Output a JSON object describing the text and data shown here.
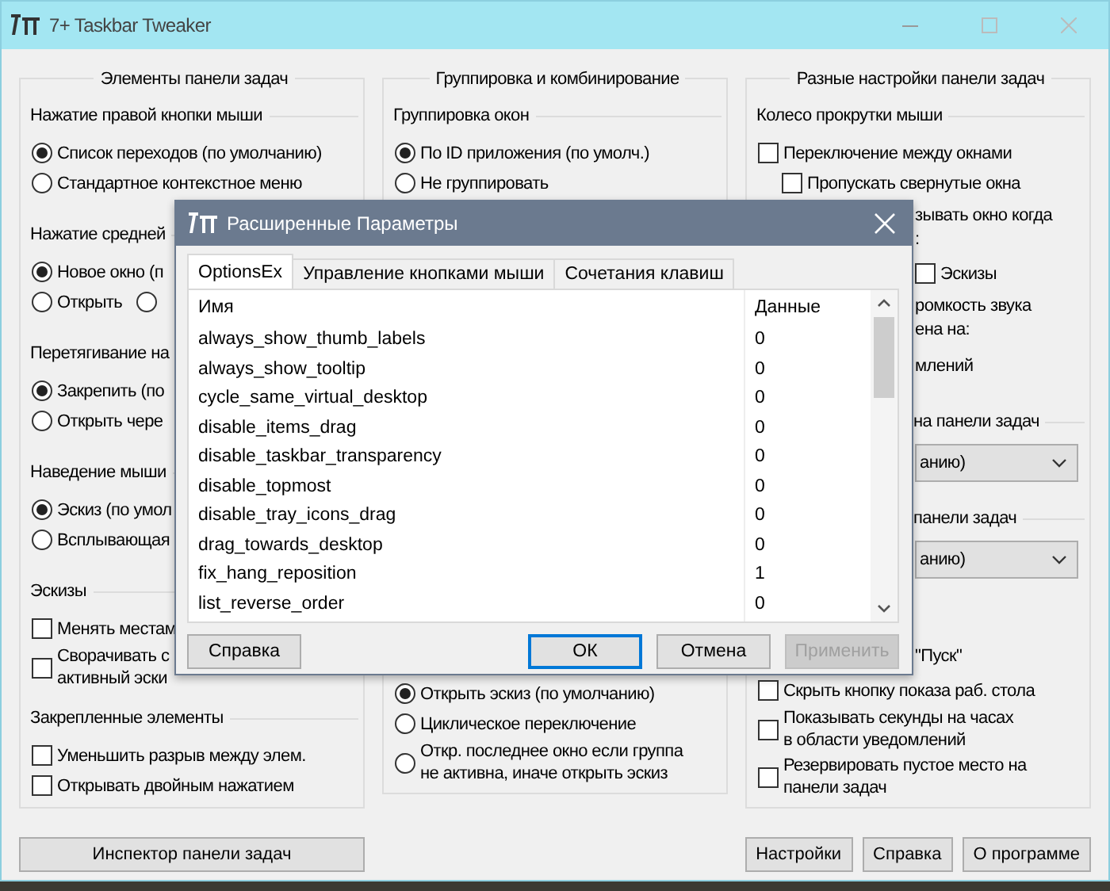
{
  "window": {
    "title": "7+ Taskbar Tweaker"
  },
  "columns": [
    {
      "title": "Элементы панели задач",
      "sections": [
        {
          "title": "Нажатие правой кнопки мыши",
          "items": [
            {
              "kind": "radio",
              "label": "Список переходов (по умолчанию)",
              "selected": true
            },
            {
              "kind": "radio",
              "label": "Стандартное контекстное меню",
              "selected": false
            }
          ]
        },
        {
          "title": "Нажатие средней",
          "items": [
            {
              "kind": "radio",
              "label": "Новое окно (п",
              "selected": true
            },
            {
              "kind": "radio-row",
              "options": [
                {
                  "label": "Открыть",
                  "selected": false
                },
                {
                  "selected": false
                }
              ]
            }
          ]
        },
        {
          "title": "Перетягивание на",
          "items": [
            {
              "kind": "radio",
              "label": "Закрепить (по",
              "selected": true
            },
            {
              "kind": "radio",
              "label": "Открыть чере",
              "selected": false
            }
          ]
        },
        {
          "title": "Наведение мыши",
          "items": [
            {
              "kind": "radio",
              "label": "Эскиз (по умол",
              "selected": true
            },
            {
              "kind": "radio",
              "label": "Всплывающая",
              "selected": false
            }
          ]
        },
        {
          "title": "Эскизы",
          "items": [
            {
              "kind": "checkbox",
              "label": "Менять местам",
              "checked": false
            },
            {
              "kind": "checkbox",
              "label": "Сворачивать с\nактивный эски",
              "checked": false
            }
          ]
        },
        {
          "title": "Закрепленные элементы",
          "items": [
            {
              "kind": "checkbox",
              "label": "Уменьшить разрыв между элем.",
              "checked": false
            },
            {
              "kind": "checkbox",
              "label": "Открывать двойным нажатием",
              "checked": false
            }
          ]
        }
      ],
      "buttons": [
        "Инспектор панели задач"
      ]
    },
    {
      "title": "Группировка и комбинирование",
      "sections": [
        {
          "title": "Группировка окон",
          "items": [
            {
              "kind": "radio",
              "label": "По ID приложения (по умолч.)",
              "selected": true
            },
            {
              "kind": "radio",
              "label": "Не группировать",
              "selected": false
            }
          ]
        },
        {
          "items": [
            {
              "kind": "radio",
              "label": "Открыть эскиз (по умолчанию)",
              "selected": true
            },
            {
              "kind": "radio",
              "label": "Циклическое переключение",
              "selected": false
            },
            {
              "kind": "radio",
              "label": "Откр. последнее окно если группа\nне активна, иначе открыть эскиз",
              "selected": false
            }
          ]
        }
      ]
    },
    {
      "title": "Разные настройки панели задач",
      "sections": [
        {
          "title": "Колесо прокрутки мыши",
          "items": [
            {
              "kind": "checkbox",
              "label": "Переключение между окнами",
              "checked": false,
              "children": [
                {
                  "kind": "checkbox",
                  "label": "Пропускать свернутые окна",
                  "checked": false
                }
              ]
            },
            {
              "kind": "text",
              "text": "зывать окно когда\n:",
              "cut_left": true
            },
            {
              "kind": "checkbox",
              "label": "Эскизы",
              "checked": false,
              "cut_left": true
            },
            {
              "kind": "text",
              "text": "ромкость звука\nена на:",
              "cut_left": true
            },
            {
              "kind": "text",
              "text": "млений",
              "cut_left": true
            }
          ]
        },
        {
          "title": "на панели задач",
          "cut_left": true,
          "items": [
            {
              "kind": "dropdown",
              "value": "анию)",
              "cut_left": true
            }
          ]
        },
        {
          "title": "панели задач",
          "cut_left": true,
          "items": [
            {
              "kind": "dropdown",
              "value": "анию)",
              "cut_left": true
            }
          ]
        },
        {
          "items": [
            {
              "kind": "text",
              "text": "\"Пуск\"",
              "cut_left": true
            },
            {
              "kind": "checkbox",
              "label": "Скрыть кнопку показа раб. стола",
              "checked": false
            },
            {
              "kind": "checkbox",
              "label": "Показывать секунды на часах\nв области уведомлений",
              "checked": false
            },
            {
              "kind": "checkbox",
              "label": "Резервировать пустое место на\nпанели задач",
              "checked": false
            }
          ]
        }
      ],
      "buttons": [
        "Настройки",
        "Справка",
        "О программе"
      ]
    }
  ],
  "dialog": {
    "title": "Расширенные Параметры",
    "tabs": [
      {
        "label": "OptionsEx",
        "selected": true
      },
      {
        "label": "Управление кнопками мыши",
        "selected": false
      },
      {
        "label": "Сочетания клавиш",
        "selected": false
      }
    ],
    "columns": [
      "Имя",
      "Данные"
    ],
    "rows": [
      {
        "name": "always_show_thumb_labels",
        "value": "0"
      },
      {
        "name": "always_show_tooltip",
        "value": "0"
      },
      {
        "name": "cycle_same_virtual_desktop",
        "value": "0"
      },
      {
        "name": "disable_items_drag",
        "value": "0"
      },
      {
        "name": "disable_taskbar_transparency",
        "value": "0"
      },
      {
        "name": "disable_topmost",
        "value": "0"
      },
      {
        "name": "disable_tray_icons_drag",
        "value": "0"
      },
      {
        "name": "drag_towards_desktop",
        "value": "0"
      },
      {
        "name": "fix_hang_reposition",
        "value": "1"
      },
      {
        "name": "list_reverse_order",
        "value": "0"
      }
    ],
    "buttons": [
      {
        "label": "Справка",
        "focused": false,
        "disabled": false
      },
      {
        "label": "ОК",
        "focused": true,
        "disabled": false
      },
      {
        "label": "Отмена",
        "focused": false,
        "disabled": false
      },
      {
        "label": "Применить",
        "focused": false,
        "disabled": true
      }
    ]
  }
}
